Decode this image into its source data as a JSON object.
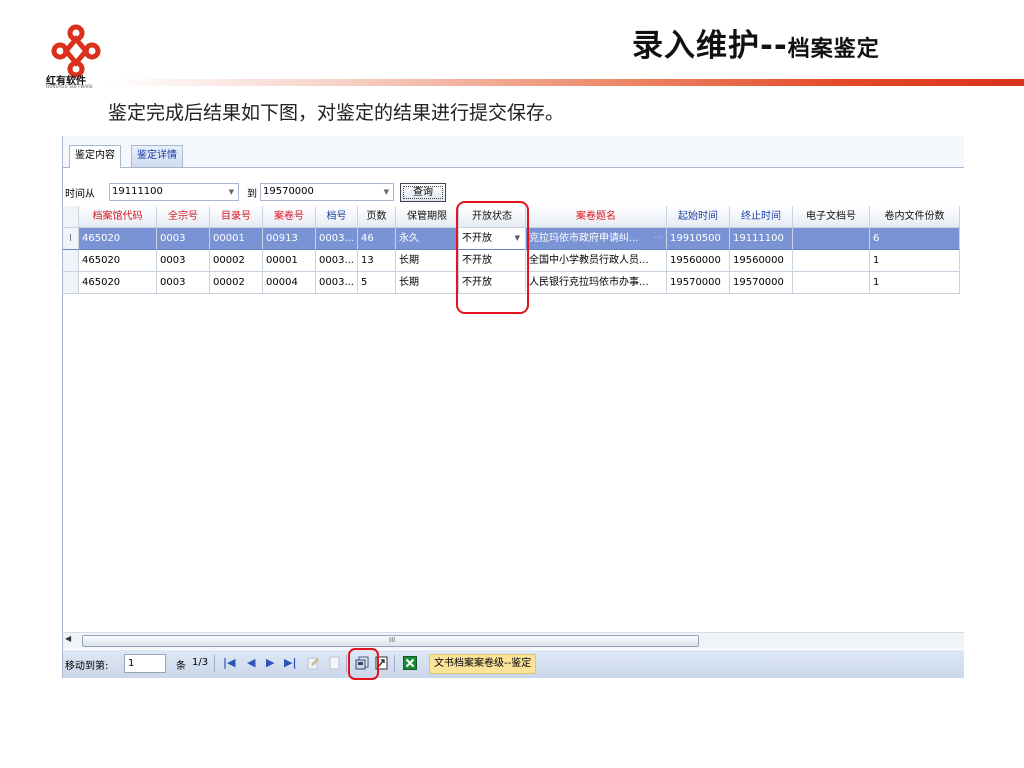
{
  "slide": {
    "title": "录入维护",
    "title_separator": "--",
    "title_sub": "档案鉴定",
    "logo_text": "红有软件",
    "logo_subtext": "HONGYOU SOFTWARE",
    "intro": "鉴定完成后结果如下图，对鉴定的结果进行提交保存。",
    "brand_color": "#d9311c"
  },
  "tabs": [
    {
      "label": "鉴定内容",
      "active": true
    },
    {
      "label": "鉴定详情",
      "active": false
    }
  ],
  "filter": {
    "from_label": "时间从",
    "from_value": "19111100",
    "to_label": "到",
    "to_value": "19570000",
    "query_label": "查询"
  },
  "grid": {
    "columns": [
      {
        "label": "档案馆代码",
        "color": "red"
      },
      {
        "label": "全宗号",
        "color": "red"
      },
      {
        "label": "目录号",
        "color": "red"
      },
      {
        "label": "案卷号",
        "color": "red"
      },
      {
        "label": "档号",
        "color": "blue"
      },
      {
        "label": "页数",
        "color": "black"
      },
      {
        "label": "保管期限",
        "color": "black"
      },
      {
        "label": "开放状态",
        "color": "black"
      },
      {
        "label": "案卷题名",
        "color": "red"
      },
      {
        "label": "起始时间",
        "color": "blue"
      },
      {
        "label": "终止时间",
        "color": "blue"
      },
      {
        "label": "电子文档号",
        "color": "black"
      },
      {
        "label": "卷内文件份数",
        "color": "black"
      }
    ],
    "rows": [
      {
        "selected": true,
        "cells": [
          "465020",
          "0003",
          "00001",
          "00913",
          "0003...",
          "46",
          "永久",
          "不开放",
          "克拉玛依市政府申请纠...",
          "19910500",
          "19111100",
          "",
          "6"
        ]
      },
      {
        "selected": false,
        "cells": [
          "465020",
          "0003",
          "00002",
          "00001",
          "0003...",
          "13",
          "长期",
          "不开放",
          "全国中小学教员行政人员...",
          "19560000",
          "19560000",
          "",
          "1"
        ]
      },
      {
        "selected": false,
        "cells": [
          "465020",
          "0003",
          "00002",
          "00004",
          "0003...",
          "5",
          "长期",
          "不开放",
          "人民银行克拉玛依市办事...",
          "19570000",
          "19570000",
          "",
          "1"
        ]
      }
    ],
    "row_marker": "I",
    "editor_ellipsis": "···"
  },
  "scrollbar": {
    "grip": "III"
  },
  "pager": {
    "goto_label": "移动到第:",
    "page_value": "1",
    "unit_label": "条",
    "position": "1/3",
    "module_label": "文书档案案卷级--鉴定"
  },
  "colors": {
    "selection": "#7a93d4",
    "header_red": "#d9141e",
    "header_blue": "#1d3fa8",
    "callout": "#e4141e"
  }
}
